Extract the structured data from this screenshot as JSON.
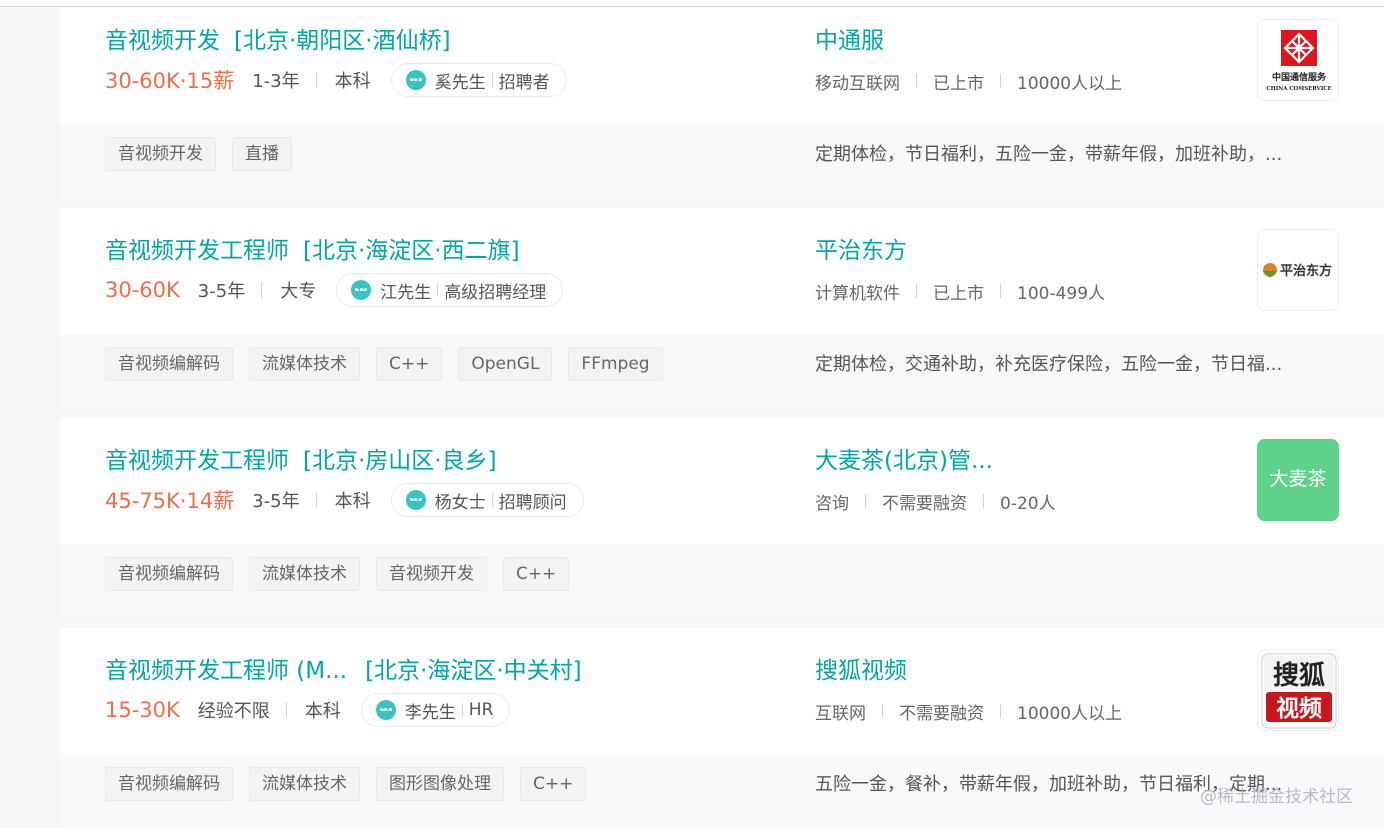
{
  "jobs": [
    {
      "title": "音视频开发",
      "area": "[北京·朝阳区·酒仙桥]",
      "salary": "30-60K·15薪",
      "experience": "1-3年",
      "degree": "本科",
      "recruiter_name": "奚先生",
      "recruiter_role": "招聘者",
      "company": "中通服",
      "company_tags": [
        "移动互联网",
        "已上市",
        "10000人以上"
      ],
      "logo": {
        "icon": "china-comservice-logo",
        "mark_color": "#e0161e",
        "text": "中国通信服务",
        "sub_text": "CHINA COMSERVICE"
      },
      "skills": [
        "音视频开发",
        "直播"
      ],
      "benefits": "定期体检，节日福利，五险一金，带薪年假，加班补助，..."
    },
    {
      "title": "音视频开发工程师",
      "area": "[北京·海淀区·西二旗]",
      "salary": "30-60K",
      "experience": "3-5年",
      "degree": "大专",
      "recruiter_name": "江先生",
      "recruiter_role": "高级招聘经理",
      "company": "平治东方",
      "company_tags": [
        "计算机软件",
        "已上市",
        "100-499人"
      ],
      "logo": {
        "icon": "pingzhi-dongfang-logo",
        "mark_color": "#d9822b",
        "text": "平治东方"
      },
      "skills": [
        "音视频编解码",
        "流媒体技术",
        "C++",
        "OpenGL",
        "FFmpeg"
      ],
      "benefits": "定期体检，交通补助，补充医疗保险，五险一金，节日福..."
    },
    {
      "title": "音视频开发工程师",
      "area": "[北京·房山区·良乡]",
      "salary": "45-75K·14薪",
      "experience": "3-5年",
      "degree": "本科",
      "recruiter_name": "杨女士",
      "recruiter_role": "招聘顾问",
      "company": "大麦茶(北京)管...",
      "company_tags": [
        "咨询",
        "不需要融资",
        "0-20人"
      ],
      "logo": {
        "icon": "damaicha-logo",
        "bg_color": "#5ed28a",
        "text": "大麦茶"
      },
      "skills": [
        "音视频编解码",
        "流媒体技术",
        "音视频开发",
        "C++"
      ],
      "benefits": ""
    },
    {
      "title": "音视频开发工程师 (M...",
      "area": "[北京·海淀区·中关村]",
      "salary": "15-30K",
      "experience": "经验不限",
      "degree": "本科",
      "recruiter_name": "李先生",
      "recruiter_role": "HR",
      "company": "搜狐视频",
      "company_tags": [
        "互联网",
        "不需要融资",
        "10000人以上"
      ],
      "logo": {
        "icon": "sohu-video-logo",
        "bg_color": "#c8161d",
        "text_top": "搜狐",
        "text_bottom": "视频"
      },
      "skills": [
        "音视频编解码",
        "流媒体技术",
        "图形图像处理",
        "C++"
      ],
      "benefits": "五险一金，餐补，带薪年假，加班补助，节日福利，定期..."
    }
  ],
  "watermark": "@稀土掘金技术社区",
  "colors": {
    "accent": "#00a6a7",
    "salary": "#f26d49",
    "chat_icon": "#3bc3c3"
  }
}
